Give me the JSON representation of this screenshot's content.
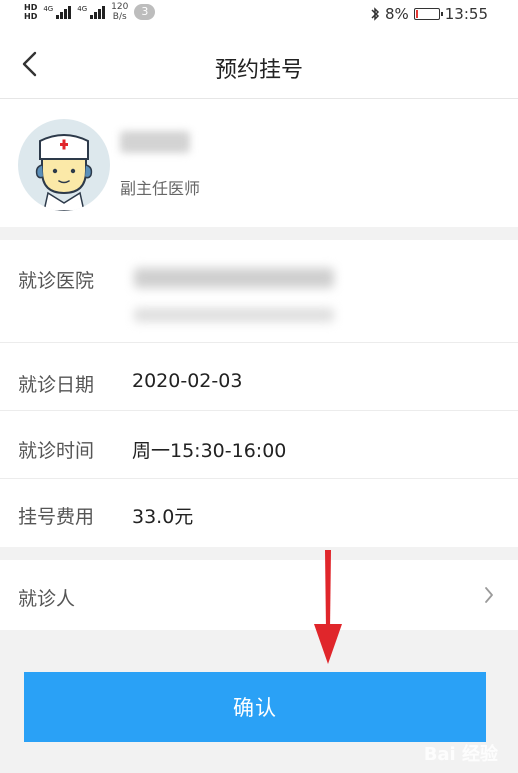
{
  "status_bar": {
    "network_type_1": "4G",
    "network_type_2": "4G",
    "speed_value": "120",
    "speed_unit": "B/s",
    "notification_count": "3",
    "battery_percent": "8%",
    "battery_level": 0.08,
    "time": "13:55"
  },
  "nav": {
    "title": "预约挂号",
    "back_icon": "chevron-left-icon"
  },
  "doctor": {
    "title": "副主任医师",
    "avatar_icon": "doctor-avatar-icon"
  },
  "appointment": {
    "hospital_label": "就诊医院",
    "date_label": "就诊日期",
    "date_value": "2020-02-03",
    "time_label": "就诊时间",
    "time_value": "周一15:30-16:00",
    "fee_label": "挂号费用",
    "fee_value": "33.0元"
  },
  "patient": {
    "label": "就诊人",
    "chevron_icon": "chevron-right-icon"
  },
  "confirm": {
    "label": "确认"
  },
  "watermark": {
    "text": "Bai 经验"
  },
  "colors": {
    "primary": "#2aa1f6",
    "annotation_arrow": "#e0262b",
    "battery_low": "#e53935"
  }
}
